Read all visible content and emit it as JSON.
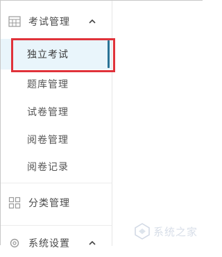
{
  "sidebar": {
    "exam_group": {
      "label": "考试管理",
      "icon": "grid-icon",
      "expanded": true
    },
    "items": [
      {
        "label": "独立考试",
        "active": true
      },
      {
        "label": "题库管理",
        "active": false
      },
      {
        "label": "试卷管理",
        "active": false
      },
      {
        "label": "阅卷管理",
        "active": false
      },
      {
        "label": "阅卷记录",
        "active": false
      }
    ],
    "category_group": {
      "label": "分类管理",
      "icon": "squares-icon"
    },
    "settings_group": {
      "label": "系统设置",
      "icon": "gear-icon"
    }
  },
  "watermark": {
    "text": "系统之家"
  },
  "colors": {
    "active_bg": "#e9f5fb",
    "active_bar": "#2a7396",
    "highlight_border": "#e0323a"
  }
}
